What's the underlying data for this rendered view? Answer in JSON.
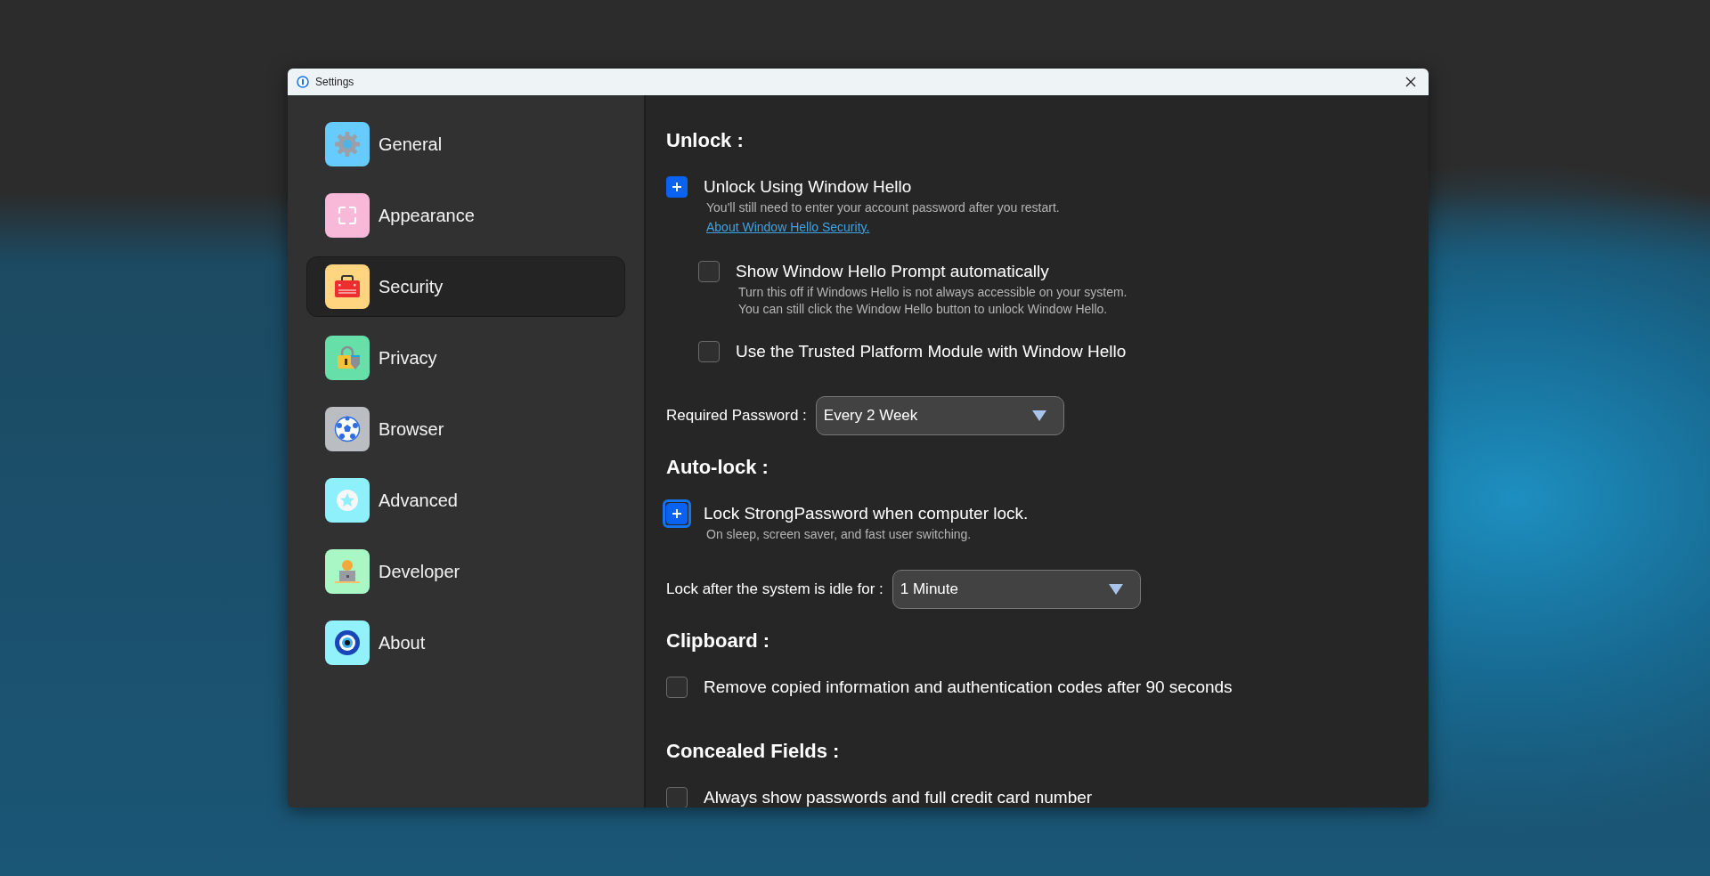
{
  "window": {
    "title": "Settings"
  },
  "sidebar": {
    "items": [
      {
        "label": "General",
        "color": "#66ccff",
        "selected": false
      },
      {
        "label": "Appearance",
        "color": "#f8b8d8",
        "selected": false
      },
      {
        "label": "Security",
        "color": "#ffd580",
        "selected": true
      },
      {
        "label": "Privacy",
        "color": "#66e0a8",
        "selected": false
      },
      {
        "label": "Browser",
        "color": "#babdc2",
        "selected": false
      },
      {
        "label": "Advanced",
        "color": "#8ef0fa",
        "selected": false
      },
      {
        "label": "Developer",
        "color": "#aaf7c6",
        "selected": false
      },
      {
        "label": "About",
        "color": "#92f2fb",
        "selected": false
      }
    ]
  },
  "sections": [
    {
      "heading": "Unlock :",
      "items": [
        {
          "kind": "checkbox",
          "label": "Unlock Using Window Hello",
          "checked": true,
          "focused": false,
          "description": [
            "You'll still need to enter your account password after you restart."
          ],
          "link": "About Window Hello Security.",
          "children": [
            {
              "kind": "checkbox",
              "label": "Show Window Hello Prompt automatically",
              "checked": false,
              "focused": false,
              "description": [
                "Turn this off if Windows Hello is not always accessible on your system.",
                "You can still click the Window Hello button to unlock Window Hello."
              ]
            },
            {
              "kind": "checkbox",
              "label": "Use the Trusted Platform Module with Window Hello",
              "checked": false,
              "focused": false
            }
          ]
        },
        {
          "kind": "select",
          "label": "Required Password :",
          "value": "Every 2 Week"
        }
      ]
    },
    {
      "heading": "Auto-lock :",
      "items": [
        {
          "kind": "checkbox",
          "label": "Lock StrongPassword when computer lock.",
          "checked": true,
          "focused": true,
          "description": [
            "On sleep, screen saver, and fast user switching."
          ]
        },
        {
          "kind": "select",
          "label": "Lock after the system is idle for :",
          "value": "1 Minute"
        }
      ]
    },
    {
      "heading": "Clipboard :",
      "items": [
        {
          "kind": "checkbox",
          "label": "Remove copied information and authentication codes after 90 seconds",
          "checked": false,
          "focused": false
        }
      ]
    },
    {
      "heading": "Concealed Fields :",
      "items": [
        {
          "kind": "checkbox",
          "label": "Always show passwords and full credit card number",
          "checked": false,
          "focused": false
        }
      ]
    }
  ]
}
